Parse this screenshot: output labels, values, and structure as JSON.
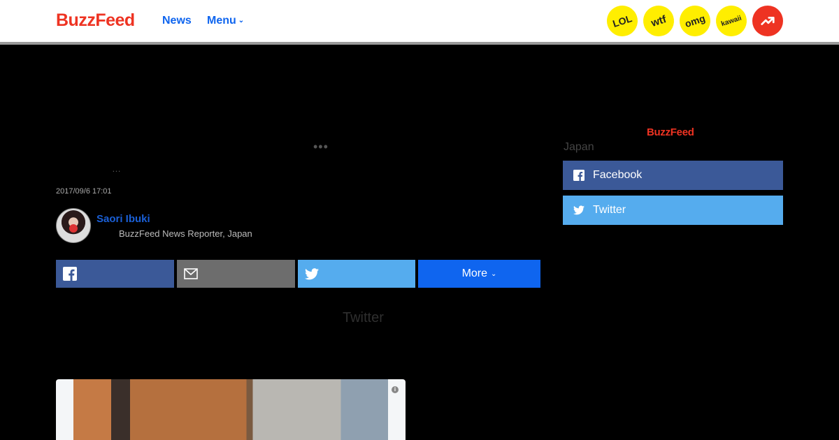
{
  "header": {
    "logo": "BuzzFeed",
    "nav": {
      "news": "News",
      "menu": "Menu"
    },
    "badges": {
      "lol": "LOL",
      "wtf": "wtf",
      "omg": "omg",
      "kawaii": "kawaii"
    },
    "trending_icon": "trending-arrow-icon"
  },
  "article": {
    "loading_dots": "•••",
    "title_ellipsis": "…",
    "date": "2017/09/6 17:01",
    "author": {
      "name": "Saori Ibuki",
      "role": "BuzzFeed News Reporter, Japan"
    },
    "share": {
      "more_label": "More"
    },
    "embed_heading": "Twitter"
  },
  "sidebar": {
    "logo": "BuzzFeed",
    "label": "Japan",
    "facebook_label": "Facebook",
    "twitter_label": "Twitter"
  },
  "colors": {
    "brand_red": "#ee3322",
    "link_blue": "#0f65ef",
    "facebook": "#3b5998",
    "twitter": "#55acee",
    "badge_yellow": "#ffee00"
  }
}
